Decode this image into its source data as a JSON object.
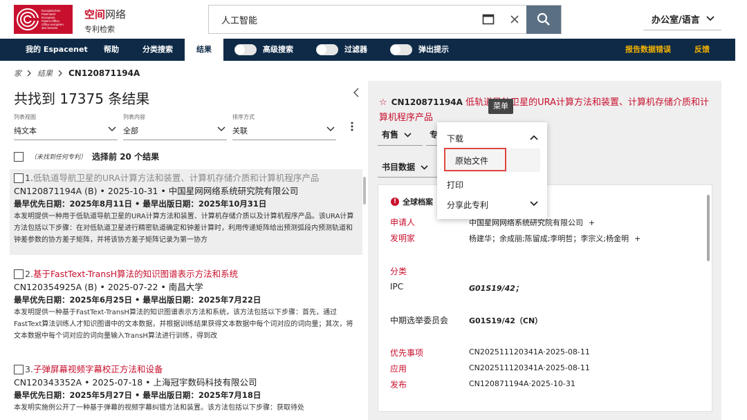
{
  "header": {
    "logo_lines": [
      "Europäisches",
      "Patentamt",
      "European",
      "Patent Office",
      "Office européen",
      "des brevets"
    ],
    "brand_title_a": "空间",
    "brand_title_b": "网络",
    "brand_subtitle": "专利检索",
    "search_value": "人工智能",
    "office_label": "办公室/语言"
  },
  "nav": {
    "items": [
      "我的 Espacenet",
      "帮助",
      "分类搜索",
      "结果"
    ],
    "toggles": [
      "高级搜索",
      "过滤器",
      "弹出提示"
    ],
    "report_error": "报告数据错误",
    "feedback": "反馈"
  },
  "breadcrumb": {
    "home": "家",
    "results": "结果",
    "current": "CN120871194A"
  },
  "results": {
    "heading": "共找到 17375 条结果",
    "list_view_label": "列表视图",
    "list_view_value": "纯文本",
    "list_content_label": "列表内容",
    "list_content_value": "全部",
    "sort_label": "排序方式",
    "sort_value": "关联",
    "select_note": "（未找到任何专利）",
    "select_top": "选择前 20 个结果",
    "items": [
      {
        "num": "1.",
        "title": "低轨道导航卫星的URA计算方法和装置、计算机存储介质和计算机程序产品",
        "meta": "CN120871194A (B)  •  2025-10-31  • 中国星网网络系统研究院有限公司",
        "dates": "最早优先日期：2025年8月11日 • 最早出版日期：2025年10月31日",
        "abstract": "本发明提供一种用于低轨道导航卫星的URA计算方法和装置、计算机存储介质以及计算机程序产品。该URA计算方法包括以下步骤：在对低轨道卫星进行精密轨道确定和钟差计算时，利用传递矩阵给出预测弧段内预测轨道和钟差参数的协方差子矩阵，并将该协方差子矩阵记录为第一协方"
      },
      {
        "num": "2.",
        "title": "基于FastText-TransH算法的知识图谱表示方法和系统",
        "meta": "CN120354925A (B)  •  2025-07-22  • 南昌大学",
        "dates": "最早优先日期：2025年6月25日 • 最早出版日期：2025年7月22日",
        "abstract": "本发明提供一种基于FastText-TransH算法的知识图谱表示方法和系统，该方法包括以下步骤：首先，通过FastText算法训练人才知识图谱中的文本数据，并根据训练结果获得文本数据中每个词对应的词向量；其次，将文本数据中每个词对应的词向量输入TransH算法进行训练，得到改"
      },
      {
        "num": "3.",
        "title": "子弹屏幕视频字幕校正方法和设备",
        "meta": "CN120343352A  •  2025-07-18  • 上海冠宇数码科技有限公司",
        "dates": "最早优先日期：2025年5月27日 • 最早出版日期：2025年7月18日",
        "abstract": "本发明实施例公开了一种基于弹幕的视频字幕纠错方法和装置。该方法包括以下步骤：获取待处"
      }
    ]
  },
  "detail": {
    "pub_number": "CN120871194A",
    "title": "低轨道导航卫星的URA计算方法和装置、计算机存储介质和计算机程序产品",
    "tooltip": "菜单",
    "btn_sale": "有售",
    "btn_patent": "专",
    "btn_biblio": "书目数据",
    "section": "全球档案",
    "applicant_label": "申请人",
    "applicant_value": "中国星网网络系统研究院有限公司",
    "inventor_label": "发明家",
    "inventor_value": "杨建华；余成丽;陈留成;李明哲；李宗义;杨金明",
    "class_label": "分类",
    "ipc_label": "IPC",
    "ipc_value": "G01S19/42；",
    "cpc_label": "中期选举委员会",
    "cpc_value": "G01S19/42（CN）",
    "priority_label": "优先事项",
    "priority_value": "CN202511120341A·2025-08-11",
    "app_label": "应用",
    "app_value": "CN202511120341A·2025-08-11",
    "pub_label": "发布",
    "pub_value": "CN120871194A·2025-10-31",
    "plus": "+"
  },
  "menu": {
    "download": "下载",
    "original": "原始文件",
    "print": "打印",
    "share": "分享此专利"
  },
  "colors": {
    "brand_red": "#c8102e",
    "nav_bg": "#0e2a47",
    "warn": "#f5b300",
    "search_btn": "#5b6f82"
  }
}
